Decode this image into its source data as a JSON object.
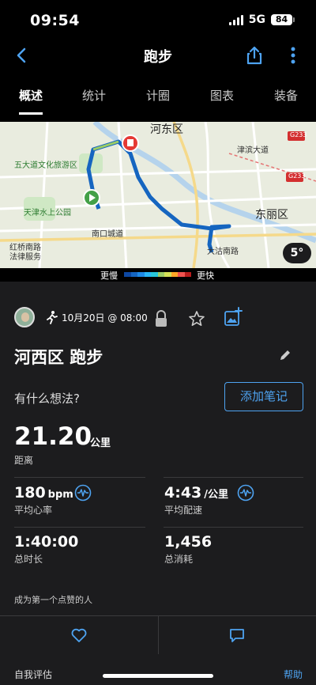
{
  "status_bar": {
    "time": "09:54",
    "network": "5G",
    "battery": "84"
  },
  "nav": {
    "title": "跑步",
    "back_icon": "chevron-left-icon",
    "share_icon": "share-icon",
    "more_icon": "more-vertical-icon"
  },
  "tabs": [
    {
      "label": "概述",
      "active": true
    },
    {
      "label": "统计",
      "active": false
    },
    {
      "label": "计圈",
      "active": false
    },
    {
      "label": "图表",
      "active": false
    },
    {
      "label": "装备",
      "active": false
    }
  ],
  "map": {
    "labels": {
      "hedong": "河东区",
      "dongli": "东丽区",
      "wudadao": "五大道文化旅游区",
      "shuishang": "天津水上公园",
      "hongqiao": "红桥南路",
      "fayuan": "法律服务",
      "tianjinwei": "津滨大道",
      "heping": "南口城道",
      "dagu": "大沽南路",
      "g233a": "G233",
      "g233b": "G233"
    },
    "temperature": "5°",
    "route_color": "#1565c0",
    "start_color": "#43a047",
    "end_color": "#e53935"
  },
  "pace_legend": {
    "slow": "更慢",
    "fast": "更快",
    "colors": [
      "#0d47a1",
      "#1565c0",
      "#1e88e5",
      "#29b6f6",
      "#26c6da",
      "#9ccc65",
      "#d4e157",
      "#ffa726",
      "#ef5350",
      "#b71c1c"
    ]
  },
  "activity": {
    "date": "10月20日 @ 08:00",
    "title": "河西区 跑步",
    "thought_prompt": "有什么想法?",
    "add_note": "添加笔记",
    "distance": {
      "value": "21.20",
      "unit": "公里",
      "label": "距离"
    },
    "heart_rate": {
      "value": "180",
      "unit": "bpm",
      "label": "平均心率"
    },
    "pace": {
      "value": "4:43",
      "unit": "/公里",
      "label": "平均配速"
    },
    "duration": {
      "value": "1:40:00",
      "label": "总时长"
    },
    "calories": {
      "value": "1,456",
      "label": "总消耗"
    },
    "kudos_text": "成为第一个点赞的人",
    "self_eval": "自我评估",
    "help": "帮助"
  },
  "colors": {
    "accent": "#4ea3f1",
    "background": "#1c1c1e",
    "divider": "#3a3a3c"
  }
}
